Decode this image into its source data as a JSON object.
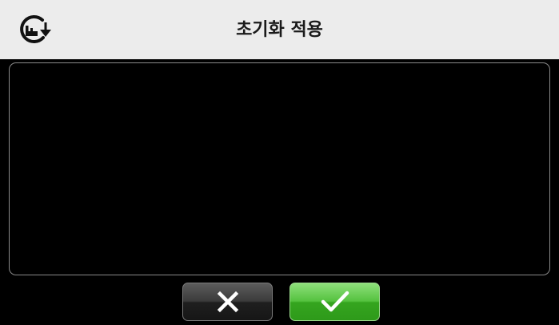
{
  "header": {
    "title": "초기화 적용",
    "icon": "restore-icon"
  },
  "content": {
    "text": ""
  },
  "buttons": {
    "cancel": {
      "icon": "close-icon"
    },
    "confirm": {
      "icon": "checkmark-icon"
    }
  },
  "colors": {
    "header_bg": "#ececec",
    "screen_bg": "#000000",
    "confirm_green": "#4cb836",
    "cancel_dark": "#2b2b2b"
  }
}
